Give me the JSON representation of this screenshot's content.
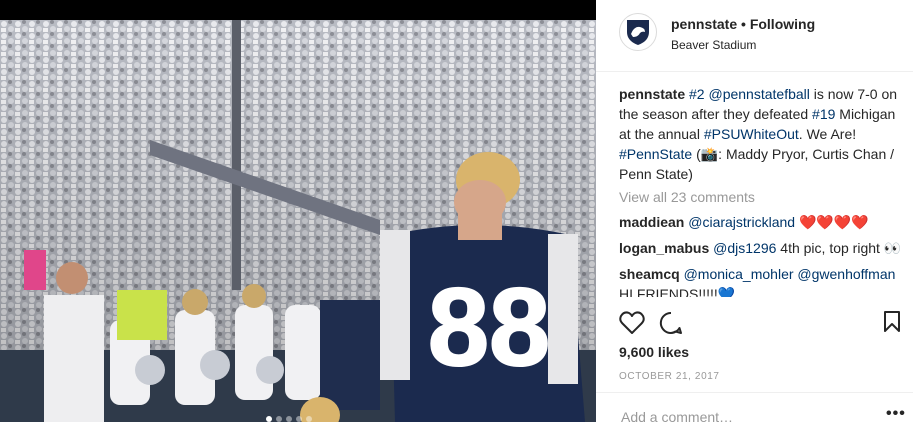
{
  "post": {
    "username": "pennstate",
    "separator": "•",
    "follow_status": "Following",
    "location": "Beaver Stadium",
    "jersey_number": "88"
  },
  "caption": {
    "username": "pennstate",
    "parts": [
      "#2",
      "@pennstatefball",
      "is now 7-0 on the season after they defeated",
      "#19",
      "Michigan at the annual",
      "#PSUWhiteOut",
      ". We Are!",
      "#PennState",
      "(",
      "📸",
      ": Maddy Pryor, Curtis Chan / Penn State)"
    ]
  },
  "view_all": "View all 23 comments",
  "comments": [
    {
      "user": "maddiean",
      "mention": "@ciarajstrickland",
      "text": "❤️❤️❤️❤️"
    },
    {
      "user": "logan_mabus",
      "mention": "@djs1296",
      "text": "4th pic, top right 👀"
    },
    {
      "user": "sheamcq",
      "mention": "@monica_mohler @gwenhoffman",
      "text": "HI FRIENDS!!!!!💙"
    }
  ],
  "likes": "9,600 likes",
  "date": "OCTOBER 21, 2017",
  "add_comment_placeholder": "Add a comment…",
  "more_label": "•••",
  "carousel": {
    "count": 5,
    "active": 1
  },
  "icons": [
    "heart-icon",
    "comment-icon",
    "bookmark-icon",
    "penn-state-shield-icon"
  ],
  "colors": {
    "link": "#003569",
    "muted": "#999999",
    "navy": "#1b2a4e"
  }
}
